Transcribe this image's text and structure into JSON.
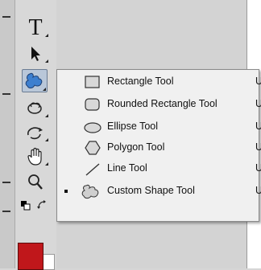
{
  "toolbar": {
    "text_tool_glyph": "T",
    "tools": [
      "text-tool",
      "path-selection-tool",
      "custom-shape-tool",
      "3d-rotate-tool",
      "3d-orbit-tool",
      "hand-tool",
      "zoom-tool"
    ],
    "foreground_color": "#c0171b",
    "background_color": "#ffffff"
  },
  "flyout": {
    "items": [
      {
        "label": "Rectangle Tool",
        "shortcut": "U",
        "icon": "rectangle-icon",
        "selected": false
      },
      {
        "label": "Rounded Rectangle Tool",
        "shortcut": "U",
        "icon": "rounded-rectangle-icon",
        "selected": false
      },
      {
        "label": "Ellipse Tool",
        "shortcut": "U",
        "icon": "ellipse-icon",
        "selected": false
      },
      {
        "label": "Polygon Tool",
        "shortcut": "U",
        "icon": "polygon-icon",
        "selected": false
      },
      {
        "label": "Line Tool",
        "shortcut": "U",
        "icon": "line-icon",
        "selected": false
      },
      {
        "label": "Custom Shape Tool",
        "shortcut": "U",
        "icon": "custom-shape-icon",
        "selected": true
      }
    ]
  }
}
